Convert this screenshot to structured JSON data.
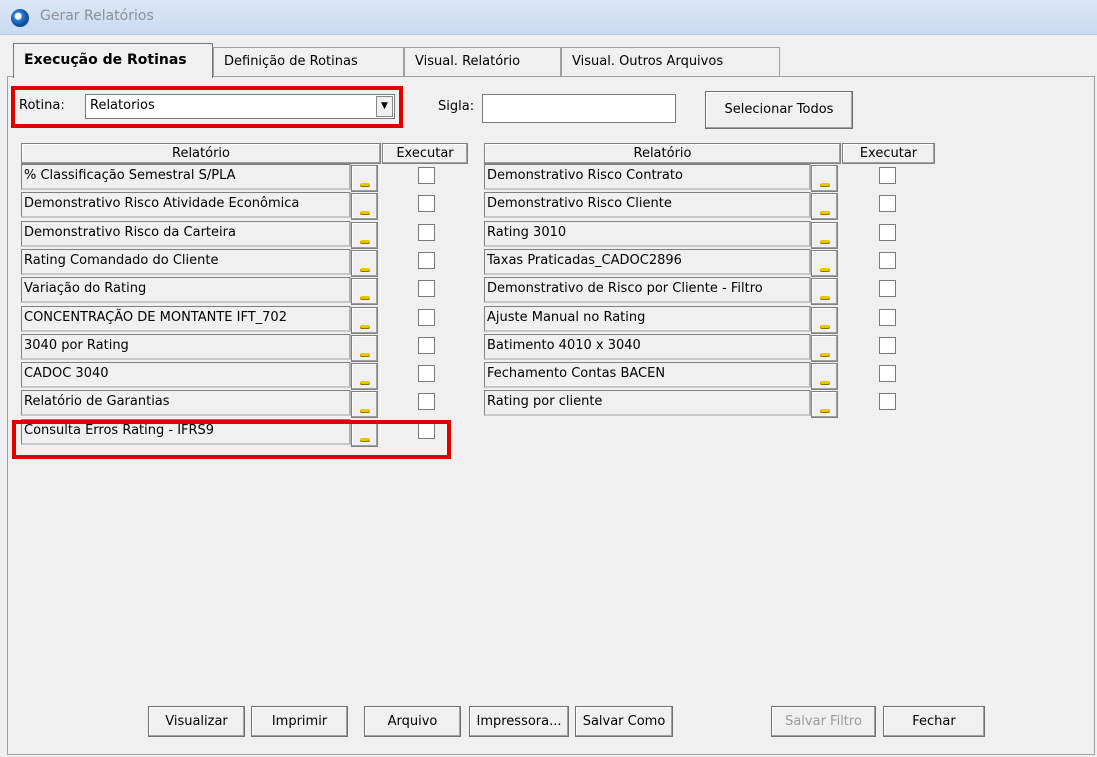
{
  "window": {
    "title": "Gerar Relatórios"
  },
  "tabs": [
    {
      "label": "Execução de Rotinas",
      "active": true
    },
    {
      "label": "Definição de Rotinas",
      "active": false
    },
    {
      "label": "Visual. Relatório",
      "active": false
    },
    {
      "label": "Visual. Outros Arquivos",
      "active": false
    }
  ],
  "filters": {
    "rotina_label": "Rotina:",
    "rotina_value": "Relatorios",
    "sigla_label": "Sigla:",
    "sigla_value": "",
    "select_all": "Selecionar Todos"
  },
  "columns": {
    "relatorio": "Relatório",
    "executar": "Executar"
  },
  "left_reports": [
    {
      "name": "% Classificação Semestral S/PLA",
      "checked": false
    },
    {
      "name": "Demonstrativo Risco Atividade Econômica",
      "checked": false
    },
    {
      "name": "Demonstrativo Risco da Carteira",
      "checked": false
    },
    {
      "name": "Rating Comandado do Cliente",
      "checked": false
    },
    {
      "name": "Variação do Rating",
      "checked": false
    },
    {
      "name": "CONCENTRAÇÃO DE MONTANTE IFT_702",
      "checked": false
    },
    {
      "name": "3040 por Rating",
      "checked": false
    },
    {
      "name": "CADOC 3040",
      "checked": false
    },
    {
      "name": "Relatório de Garantias",
      "checked": false
    },
    {
      "name": "Consulta Erros Rating - IFRS9",
      "checked": false
    }
  ],
  "right_reports": [
    {
      "name": "Demonstrativo Risco  Contrato",
      "checked": false
    },
    {
      "name": "Demonstrativo Risco Cliente",
      "checked": false
    },
    {
      "name": "Rating 3010",
      "checked": false
    },
    {
      "name": "Taxas Praticadas_CADOC2896",
      "checked": false
    },
    {
      "name": "Demonstrativo de Risco por Cliente - Filtro",
      "checked": false
    },
    {
      "name": "Ajuste Manual no Rating",
      "checked": false
    },
    {
      "name": "Batimento 4010 x 3040",
      "checked": false
    },
    {
      "name": "Fechamento Contas BACEN",
      "checked": false
    },
    {
      "name": "Rating por cliente",
      "checked": false
    }
  ],
  "buttons": {
    "visualizar": "Visualizar",
    "imprimir": "Imprimir",
    "arquivo": "Arquivo",
    "impressora": "Impressora...",
    "salvar_como": "Salvar Como",
    "salvar_filtro": "Salvar Filtro",
    "fechar": "Fechar"
  },
  "icons": {
    "app": "app-logo-icon",
    "row_action": "ellipsis-icon",
    "combo_arrow": "chevron-down-icon"
  },
  "colors": {
    "highlight": "#e00000",
    "titlebar": "#dbe7f6",
    "ellipsis": "#e8c700"
  }
}
